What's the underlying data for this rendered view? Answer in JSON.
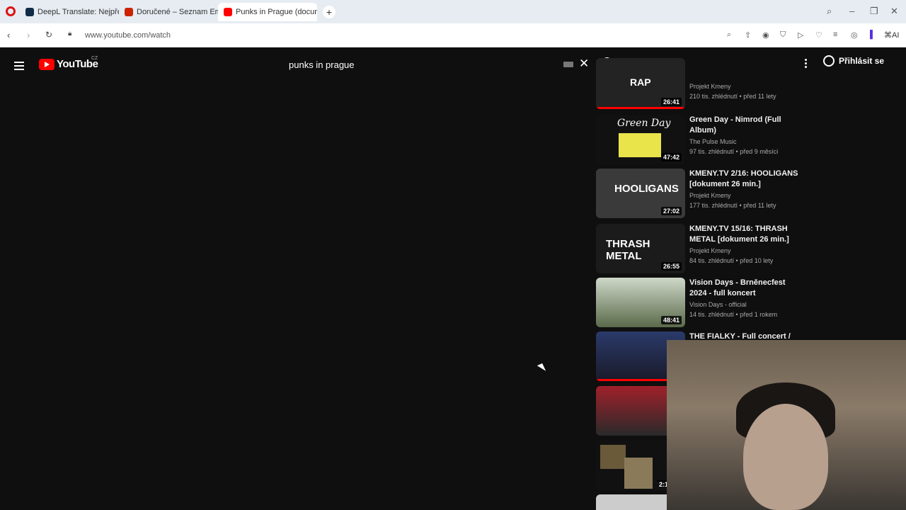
{
  "browser": {
    "tabs": [
      {
        "label": "DeepL Translate: Nejpřesn",
        "color": "#0f2b46"
      },
      {
        "label": "Doručené – Seznam Email",
        "color": "#cc2200"
      },
      {
        "label": "Punks in Prague (docume",
        "color": "#ff0000"
      }
    ],
    "url": "www.youtube.com/watch",
    "ai_label": "AI"
  },
  "youtube": {
    "logo": "YouTube",
    "region": "CZ",
    "search_query": "punks in prague",
    "signin_label": "Přihlásit se"
  },
  "videos": [
    {
      "title": "",
      "channel": "Projekt Kmeny",
      "stats": "210 tis. zhlédnutí • před 11 lety",
      "duration": "26:41",
      "thumb_text": "RAP",
      "progress": 1.0
    },
    {
      "title": "Green Day - Nimrod (Full Album)",
      "channel": "The Pulse Music",
      "stats": "97 tis. zhlédnutí • před 9 měsíci",
      "duration": "47:42",
      "thumb_text": "Green Day",
      "progress": 0
    },
    {
      "title": "KMENY.TV 2/16: HOOLIGANS [dokument 26 min.]",
      "channel": "Projekt Kmeny",
      "stats": "177 tis. zhlédnutí • před 11 lety",
      "duration": "27:02",
      "thumb_text": "HOOLIGANS",
      "progress": 0
    },
    {
      "title": "KMENY.TV 15/16: THRASH METAL [dokument 26 min.]",
      "channel": "Projekt Kmeny",
      "stats": "84 tis. zhlédnutí • před 10 lety",
      "duration": "26:55",
      "thumb_text": "THRASH METAL",
      "progress": 0
    },
    {
      "title": "Vision Days - Brněnecfest 2024 - full koncert",
      "channel": "Vision Days - official",
      "stats": "14 tis. zhlédnutí • před 1 rokem",
      "duration": "48:41",
      "thumb_text": "",
      "progress": 0
    },
    {
      "title": "THE FIALKY - Full concert /",
      "channel": "",
      "stats": "",
      "duration": "",
      "thumb_text": "",
      "progress": 0.8
    },
    {
      "title": "",
      "channel": "",
      "stats": "",
      "duration": "",
      "thumb_text": "",
      "progress": 0
    },
    {
      "title": "",
      "channel": "",
      "stats": "",
      "duration": "2:1",
      "thumb_text": "",
      "progress": 0
    }
  ]
}
